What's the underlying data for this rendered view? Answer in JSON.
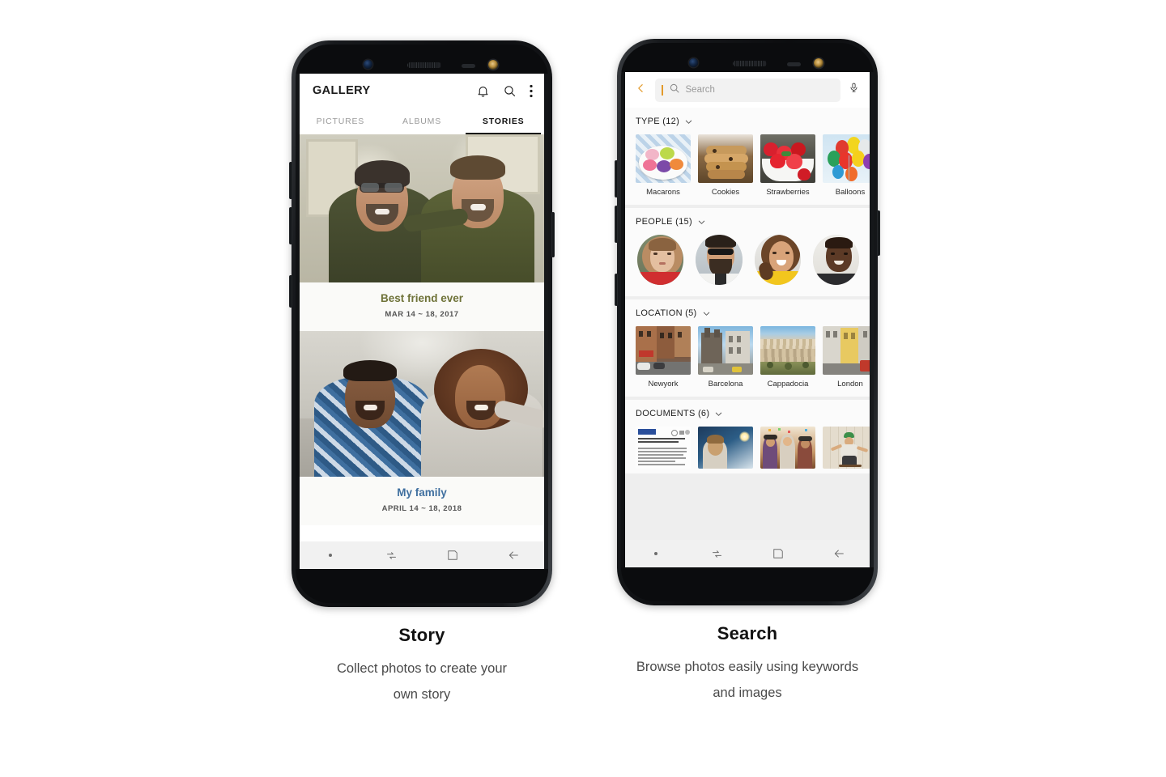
{
  "panels": [
    {
      "id": "story",
      "caption_title": "Story",
      "caption_sub_line1": "Collect photos to create your",
      "caption_sub_line2": "own story",
      "app": {
        "title": "GALLERY",
        "header_icons": [
          "bell-icon",
          "search-icon",
          "overflow-menu-icon"
        ],
        "tabs": [
          {
            "label": "PICTURES",
            "active": false
          },
          {
            "label": "ALBUMS",
            "active": false
          },
          {
            "label": "STORIES",
            "active": true
          }
        ],
        "stories": [
          {
            "title": "Best friend ever",
            "date": "MAR 14 ~ 18, 2017",
            "title_color": "#6e7238",
            "photo_alt": "two-men-smiling-indoors"
          },
          {
            "title": "My family",
            "date": "APRIL 14 ~ 18, 2018",
            "title_color": "#3f6f9f",
            "photo_alt": "couple-selfie-outdoors"
          }
        ],
        "navbar": [
          "dot-icon",
          "recents-icon",
          "home-icon",
          "back-icon"
        ]
      }
    },
    {
      "id": "search",
      "caption_title": "Search",
      "caption_sub_line1": "Browse photos easily using keywords",
      "caption_sub_line2": "and images",
      "app": {
        "back_icon": "back-chevron-icon",
        "search_placeholder": "Search",
        "search_value": "",
        "search_icon": "search-icon",
        "mic_icon": "microphone-icon",
        "accent_color": "#e39a2a",
        "sections": [
          {
            "label": "TYPE (12)",
            "kind": "tiles",
            "chevron": "chevron-down-icon",
            "items": [
              {
                "label": "Macarons",
                "art": "macarons"
              },
              {
                "label": "Cookies",
                "art": "cookies"
              },
              {
                "label": "Strawberries",
                "art": "strawberries"
              },
              {
                "label": "Balloons",
                "art": "balloons"
              }
            ]
          },
          {
            "label": "PEOPLE (15)",
            "kind": "avatars",
            "chevron": "chevron-down-icon",
            "items": [
              {
                "label": "",
                "art": "person-woman-red"
              },
              {
                "label": "",
                "art": "person-man-sunglasses"
              },
              {
                "label": "",
                "art": "person-woman-yellow"
              },
              {
                "label": "",
                "art": "person-man-dark"
              }
            ]
          },
          {
            "label": "LOCATION (5)",
            "kind": "tiles",
            "chevron": "chevron-down-icon",
            "items": [
              {
                "label": "Newyork",
                "art": "newyork"
              },
              {
                "label": "Barcelona",
                "art": "barcelona"
              },
              {
                "label": "Cappadocia",
                "art": "cappadocia"
              },
              {
                "label": "London",
                "art": "london"
              }
            ]
          },
          {
            "label": "DOCUMENTS (6)",
            "kind": "tiles-cropped",
            "chevron": "chevron-down-icon",
            "items": [
              {
                "label": "",
                "art": "document-page"
              },
              {
                "label": "",
                "art": "doc-photo-boy"
              },
              {
                "label": "",
                "art": "doc-photo-party"
              },
              {
                "label": "",
                "art": "doc-photo-skater"
              }
            ]
          }
        ],
        "navbar": [
          "dot-icon",
          "recents-icon",
          "home-icon",
          "back-icon"
        ]
      }
    }
  ]
}
